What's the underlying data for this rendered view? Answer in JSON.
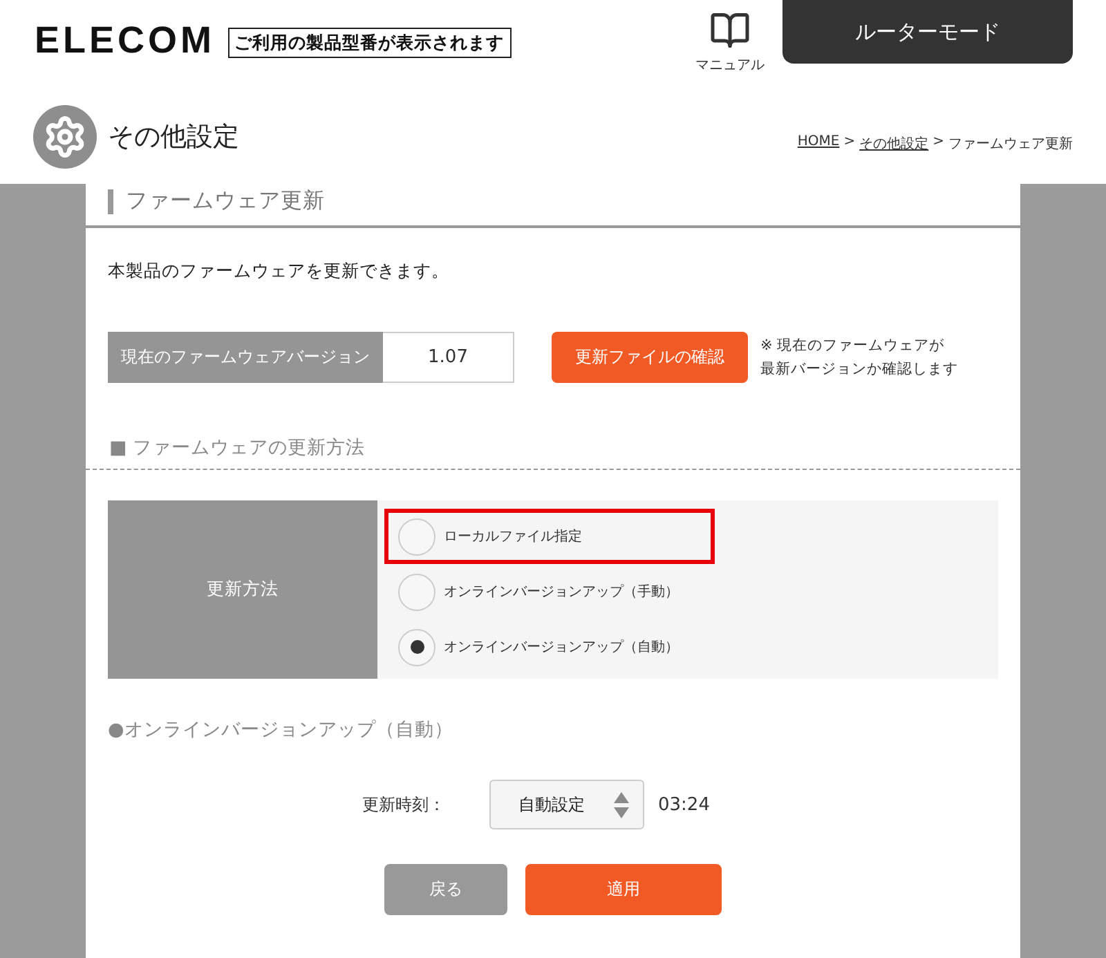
{
  "header": {
    "logo": "ELECOM",
    "model_notice": "ご利用の製品型番が表示されます",
    "manual_link": "マニュアル",
    "mode": "ルーターモード"
  },
  "page_title": "その他設定",
  "breadcrumb": {
    "separator": ">",
    "items": [
      {
        "label": "HOME",
        "link": true
      },
      {
        "label": "その他設定",
        "link": true
      },
      {
        "label": "ファームウェア更新",
        "link": false
      }
    ]
  },
  "section": {
    "title": "ファームウェア更新",
    "description": "本製品のファームウェアを更新できます。"
  },
  "version": {
    "label": "現在のファームウェアバージョン",
    "value": "1.07",
    "check_button": "更新ファイルの確認",
    "note_lines": [
      "※ 現在のファームウェアが",
      "最新バージョンか確認します"
    ]
  },
  "update_method": {
    "heading": "■ ファームウェアの更新方法",
    "label": "更新方法",
    "options": [
      {
        "label": "ローカルファイル指定",
        "selected": false,
        "highlighted": true
      },
      {
        "label": "オンラインバージョンアップ（手動）",
        "selected": false,
        "highlighted": false
      },
      {
        "label": "オンラインバージョンアップ（自動）",
        "selected": true,
        "highlighted": false
      }
    ]
  },
  "auto_update": {
    "heading": "●オンラインバージョンアップ（自動）",
    "time_label": "更新時刻：",
    "time_select": "自動設定",
    "time_value": "03:24"
  },
  "buttons": [
    {
      "label": "戻る",
      "kind": "secondary"
    },
    {
      "label": "適用",
      "kind": "primary"
    }
  ]
}
